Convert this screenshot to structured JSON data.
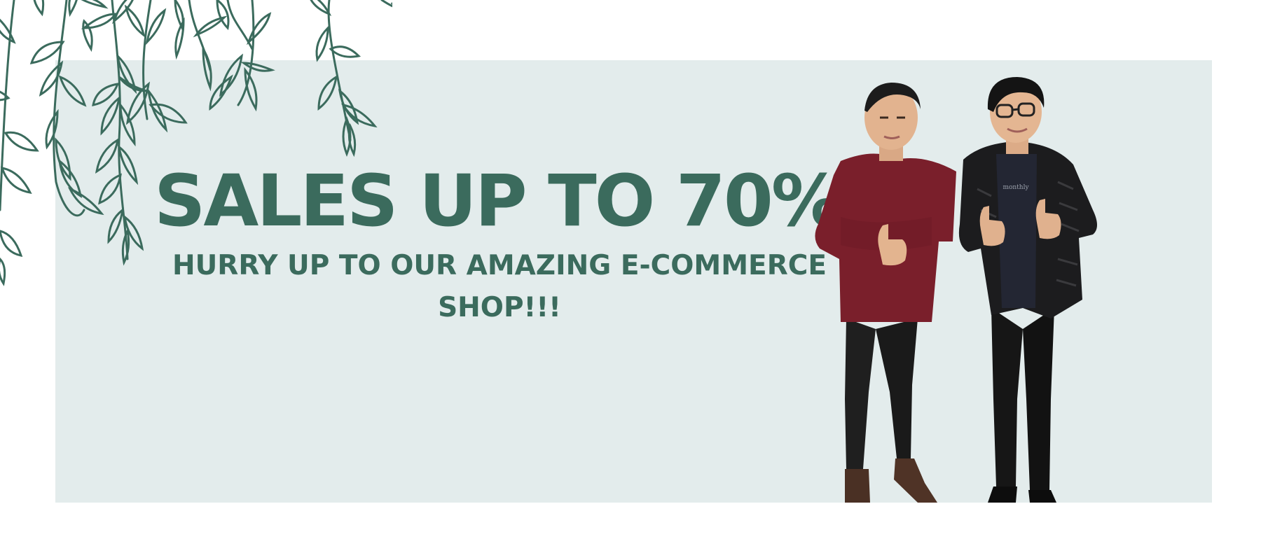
{
  "banner": {
    "headline": "SALES UP TO 70%",
    "subheadline": "HURRY UP TO OUR AMAZING E-COMMERCE SHOP!!!",
    "photo_shirt_print": "monthly"
  },
  "colors": {
    "page_background": "#ffffff",
    "panel_background": "#e3ecec",
    "accent_green": "#3b6b5d",
    "sweater_red": "#7a1f2b",
    "jacket_black": "#1c1c1e"
  },
  "icons": {
    "decoration": "hanging-vines-illustration",
    "photo": "two-people-thumbs-up-photo"
  }
}
